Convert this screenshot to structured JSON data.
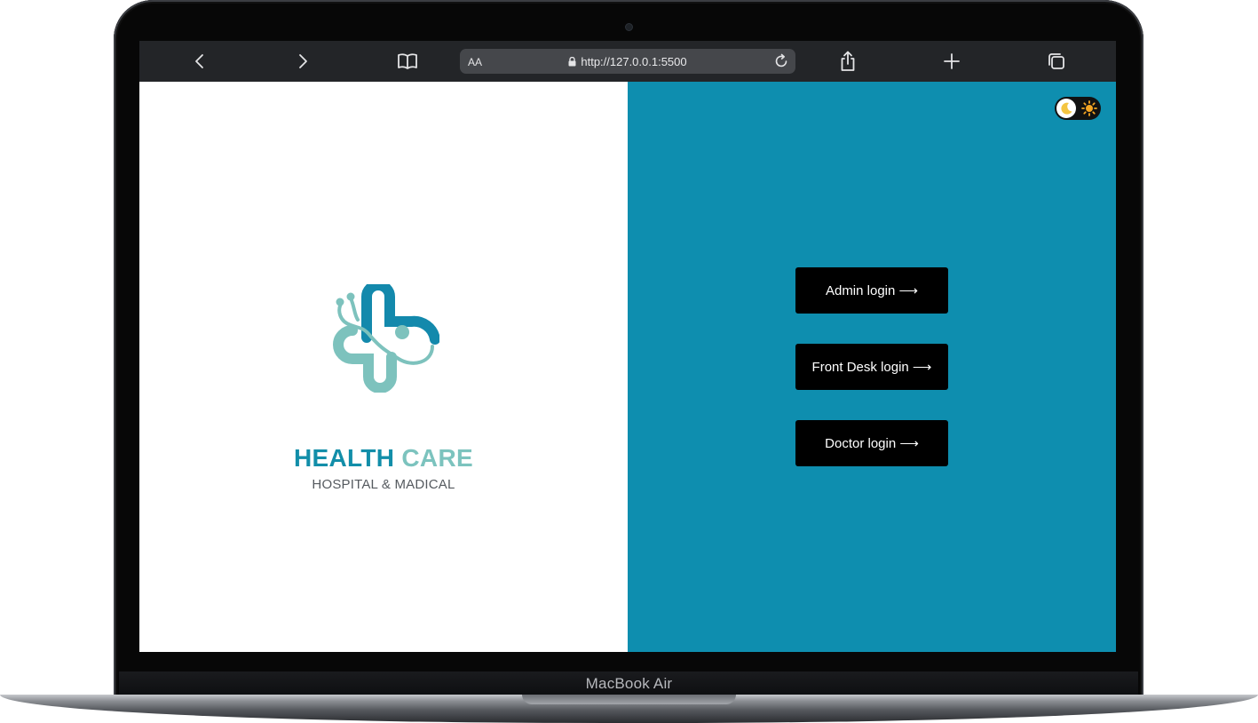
{
  "device": {
    "label": "MacBook Air"
  },
  "browser": {
    "text_size_label": "AA",
    "url": "http://127.0.0.1:5500"
  },
  "brand": {
    "word1": "HEALTH",
    "word2": "CARE",
    "tagline": "HOSPITAL & MADICAL",
    "colors": {
      "primary": "#128ea9",
      "secondary": "#7cc3be"
    }
  },
  "logins": [
    {
      "label": "Admin login ⟶"
    },
    {
      "label": "Front Desk login ⟶"
    },
    {
      "label": "Doctor login ⟶"
    }
  ],
  "theme_toggle": {
    "icons": [
      "moon-icon",
      "sun-icon"
    ],
    "moon": "🌙",
    "sun": "☀"
  },
  "colors": {
    "panel": "#0e8eaf",
    "button": "#000000"
  }
}
